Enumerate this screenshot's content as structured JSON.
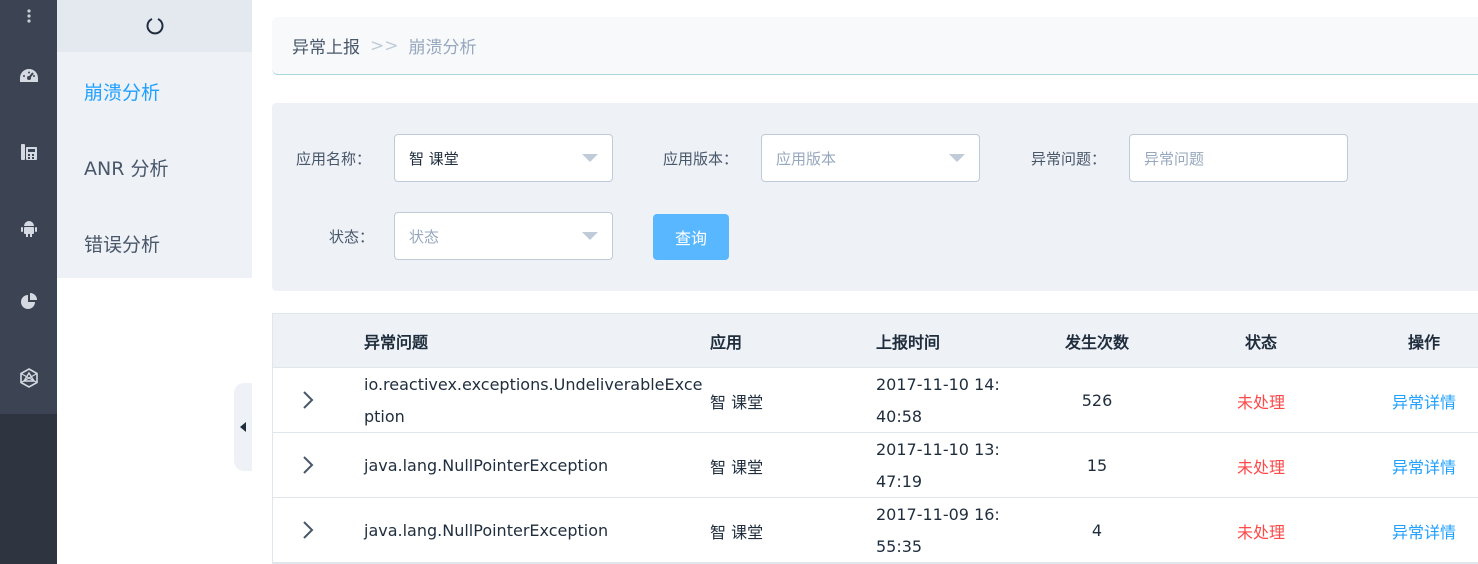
{
  "rail": {
    "icons": [
      "more-vert-icon",
      "dashboard-gauge-icon",
      "phone-icon",
      "android-icon",
      "pie-chart-icon",
      "network-icon"
    ]
  },
  "submenu": {
    "items": [
      {
        "label": "崩溃分析",
        "active": true
      },
      {
        "label": "ANR 分析",
        "active": false
      },
      {
        "label": "错误分析",
        "active": false
      }
    ]
  },
  "breadcrumb": {
    "home": "异常上报",
    "separator": ">>",
    "current": "崩溃分析"
  },
  "filters": {
    "app_name": {
      "label": "应用名称：",
      "value": "智 课堂"
    },
    "app_version": {
      "label": "应用版本：",
      "placeholder": "应用版本"
    },
    "issue": {
      "label": "异常问题：",
      "placeholder": "异常问题"
    },
    "status": {
      "label": "状态：",
      "placeholder": "状态"
    },
    "query_label": "查询"
  },
  "table": {
    "headers": {
      "issue": "异常问题",
      "app": "应用",
      "time": "上报时间",
      "count": "发生次数",
      "status": "状态",
      "action": "操作"
    },
    "rows": [
      {
        "issue_line1": "io.reactivex.exceptions.UndeliverableExce",
        "issue_line2": "ption",
        "app": "智 课堂",
        "time_line1": "2017-11-10 14:",
        "time_line2": "40:58",
        "count": "526",
        "status": "未处理",
        "action": "异常详情"
      },
      {
        "issue_line1": "java.lang.NullPointerException",
        "issue_line2": "",
        "app": "智 课堂",
        "time_line1": "2017-11-10 13:",
        "time_line2": "47:19",
        "count": "15",
        "status": "未处理",
        "action": "异常详情"
      },
      {
        "issue_line1": "java.lang.NullPointerException",
        "issue_line2": "",
        "app": "智 课堂",
        "time_line1": "2017-11-09 16:",
        "time_line2": "55:35",
        "count": "4",
        "status": "未处理",
        "action": "异常详情"
      }
    ]
  },
  "colors": {
    "accent": "#20a0ff",
    "button": "#58b7ff",
    "danger": "#ff4949",
    "rail": "#3c4453"
  }
}
